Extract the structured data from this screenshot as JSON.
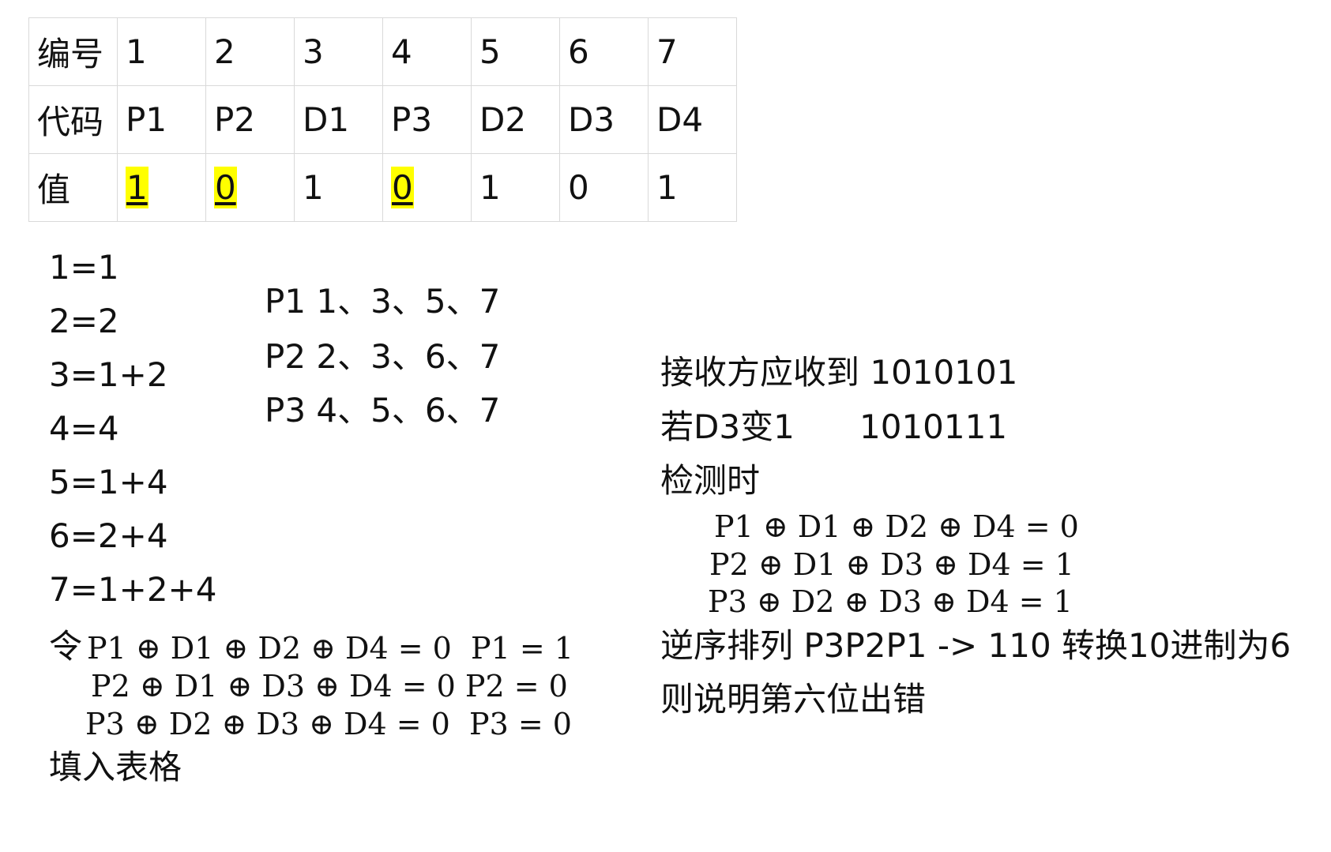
{
  "table": {
    "rows": [
      {
        "head": "编号",
        "cells": [
          "1",
          "2",
          "3",
          "4",
          "5",
          "6",
          "7"
        ]
      },
      {
        "head": "代码",
        "cells": [
          "P1",
          "P2",
          "D1",
          "P3",
          "D2",
          "D3",
          "D4"
        ]
      },
      {
        "head": "值",
        "cells": [
          "1",
          "0",
          "1",
          "0",
          "1",
          "0",
          "1"
        ]
      }
    ],
    "highlighted_value_columns": [
      0,
      1,
      3
    ],
    "highlight_color": "#ffff00"
  },
  "positions_list": [
    "1=1",
    "2=2",
    "3=1+2",
    "4=4",
    "5=1+4",
    "6=2+4",
    "7=1+2+4"
  ],
  "parity_coverage": [
    "P1 1、3、5、7",
    "P2 2、3、6、7",
    "P3 4、5、6、7"
  ],
  "equations": {
    "prefix": "令",
    "lines": [
      "P1 ⊕ D1 ⊕ D2 ⊕ D4 = 0  P1 = 1",
      "P2 ⊕ D1 ⊕ D3 ⊕ D4 = 0 P2 = 0",
      "P3 ⊕ D2 ⊕ D3 ⊕ D4 = 0  P3 = 0"
    ],
    "fill_note": "填入表格"
  },
  "right": {
    "received": "接收方应收到 1010101",
    "error_label": "若D3变1",
    "error_value": "1010111",
    "check_label": "检测时",
    "check_lines": [
      "P1 ⊕ D1 ⊕ D2 ⊕ D4 = 0",
      "P2 ⊕ D1 ⊕ D3 ⊕ D4 = 1",
      "P3 ⊕ D2 ⊕ D3 ⊕ D4 = 1"
    ],
    "reverse": "逆序排列 P3P2P1 -> 110 转换10进制为6",
    "conclusion": "则说明第六位出错"
  }
}
